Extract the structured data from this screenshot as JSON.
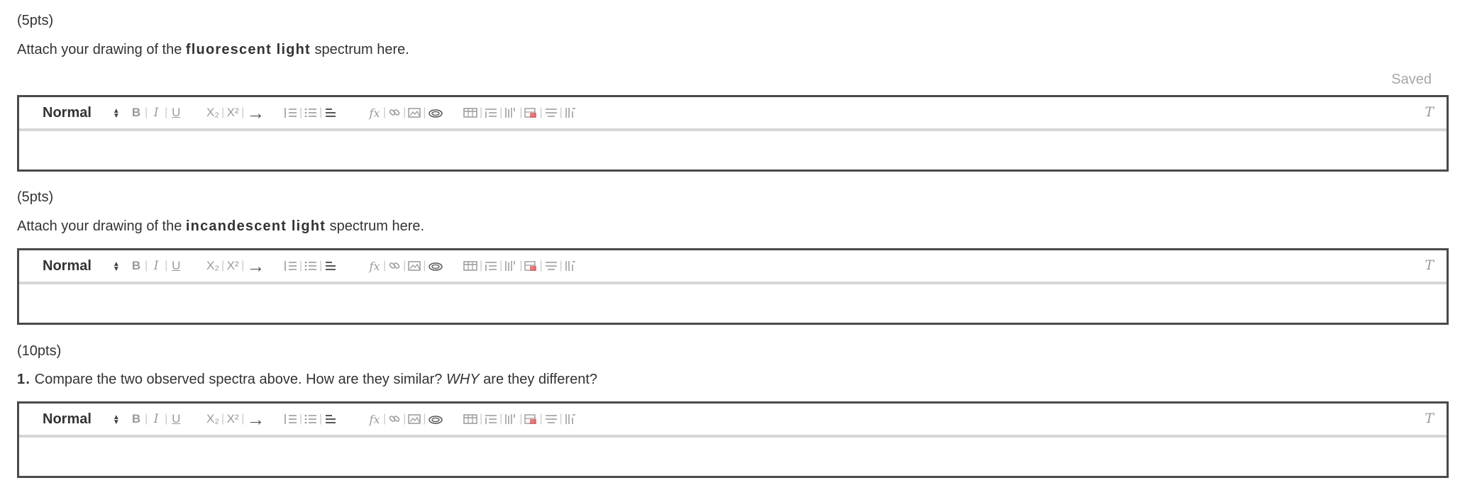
{
  "saved_label": "Saved",
  "questions": [
    {
      "points": "(5pts)",
      "prefix": "Attach your drawing of the ",
      "bold": "fluorescent light",
      "suffix": " spectrum here."
    },
    {
      "points": "(5pts)",
      "prefix": "Attach your drawing of the ",
      "bold": "incandescent light",
      "suffix": " spectrum here."
    },
    {
      "points": "(10pts)",
      "number": "1.",
      "text_before": " Compare the two observed spectra above. How are they similar? ",
      "italic": "WHY",
      "text_after": " are they different?"
    }
  ],
  "toolbar": {
    "format_label": "Normal",
    "bold": "B",
    "italic": "I",
    "underline": "U",
    "subscript": "X₂",
    "superscript": "X²",
    "arrow": "→",
    "formula": "𝑓x",
    "clear_format": "T"
  },
  "editors": [
    {
      "content": ""
    },
    {
      "content": ""
    },
    {
      "content": ""
    }
  ]
}
